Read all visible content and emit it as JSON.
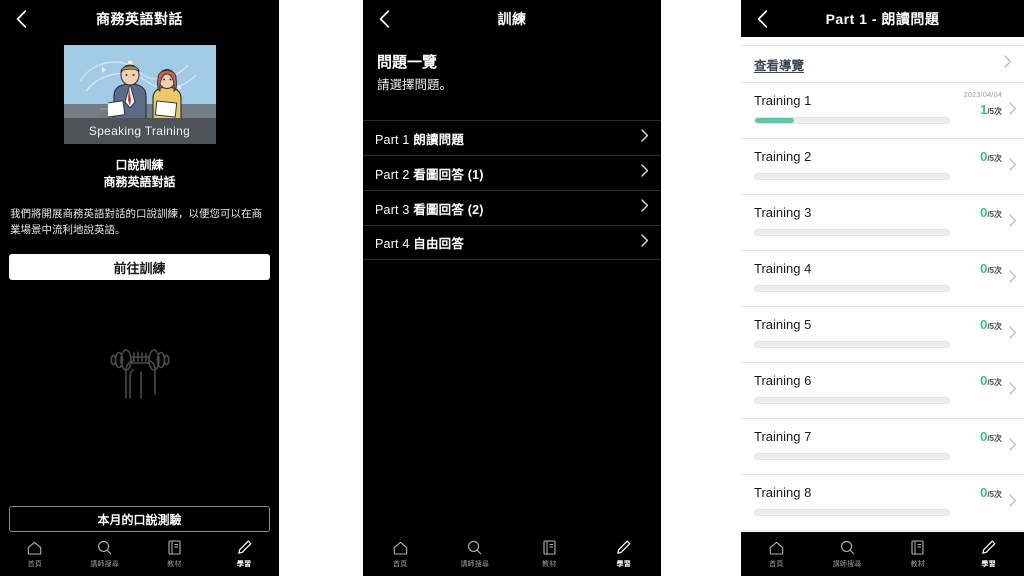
{
  "panel1": {
    "nav": {
      "back_icon": "chevron-left-icon",
      "title": "商務英語對話"
    },
    "thumbnail": {
      "caption": "Speaking Training",
      "sky_color": "#a4cbe5",
      "band_color": "#4d5358"
    },
    "subtitle_line1": "口說訓練",
    "subtitle_line2": "商務英語對話",
    "description": "我們將開展商務英語對話的口說訓練，以便您可以在商業場景中流利地說英語。",
    "primary_button": "前往訓練",
    "decor_icon": "dumbbell-icon",
    "secondary_button": "本月的口說測驗",
    "tabs": [
      {
        "label": "首頁",
        "icon": "home-icon",
        "active": false
      },
      {
        "label": "講師搜尋",
        "icon": "search-icon",
        "active": false
      },
      {
        "label": "教材",
        "icon": "book-icon",
        "active": false
      },
      {
        "label": "學習",
        "icon": "pencil-icon",
        "active": true
      }
    ]
  },
  "panel2": {
    "nav": {
      "back_icon": "chevron-left-icon",
      "title": "訓練"
    },
    "heading": "問題一覽",
    "subheading": "請選擇問題。",
    "parts": [
      {
        "number": "Part 1",
        "title": "朗讀問題",
        "chevron": "chevron-right-icon"
      },
      {
        "number": "Part 2",
        "title": "看圖回答 (1)",
        "chevron": "chevron-right-icon"
      },
      {
        "number": "Part 3",
        "title": "看圖回答 (2)",
        "chevron": "chevron-right-icon"
      },
      {
        "number": "Part 4",
        "title": "自由回答",
        "chevron": "chevron-right-icon"
      }
    ],
    "tabs": [
      {
        "label": "首頁",
        "icon": "home-icon",
        "active": false
      },
      {
        "label": "講師搜尋",
        "icon": "search-icon",
        "active": false
      },
      {
        "label": "教材",
        "icon": "book-icon",
        "active": false
      },
      {
        "label": "學習",
        "icon": "pencil-icon",
        "active": true
      }
    ]
  },
  "panel3": {
    "nav": {
      "back_icon": "chevron-left-icon",
      "title": "Part 1 - 朗讀問題"
    },
    "guide_link": "查看導覽",
    "progress_color": "#5ac8a0",
    "trainings": [
      {
        "name": "Training 1",
        "date": "2023/04/04",
        "current": "1",
        "total": "/5次",
        "percent": 20
      },
      {
        "name": "Training 2",
        "date": "",
        "current": "0",
        "total": "/5次",
        "percent": 0
      },
      {
        "name": "Training 3",
        "date": "",
        "current": "0",
        "total": "/5次",
        "percent": 0
      },
      {
        "name": "Training 4",
        "date": "",
        "current": "0",
        "total": "/5次",
        "percent": 0
      },
      {
        "name": "Training 5",
        "date": "",
        "current": "0",
        "total": "/5次",
        "percent": 0
      },
      {
        "name": "Training 6",
        "date": "",
        "current": "0",
        "total": "/5次",
        "percent": 0
      },
      {
        "name": "Training 7",
        "date": "",
        "current": "0",
        "total": "/5次",
        "percent": 0
      },
      {
        "name": "Training 8",
        "date": "",
        "current": "0",
        "total": "/5次",
        "percent": 0
      }
    ],
    "tabs": [
      {
        "label": "首頁",
        "icon": "home-icon",
        "active": false
      },
      {
        "label": "講師搜尋",
        "icon": "search-icon",
        "active": false
      },
      {
        "label": "教材",
        "icon": "book-icon",
        "active": false
      },
      {
        "label": "學習",
        "icon": "pencil-icon",
        "active": true
      }
    ]
  }
}
